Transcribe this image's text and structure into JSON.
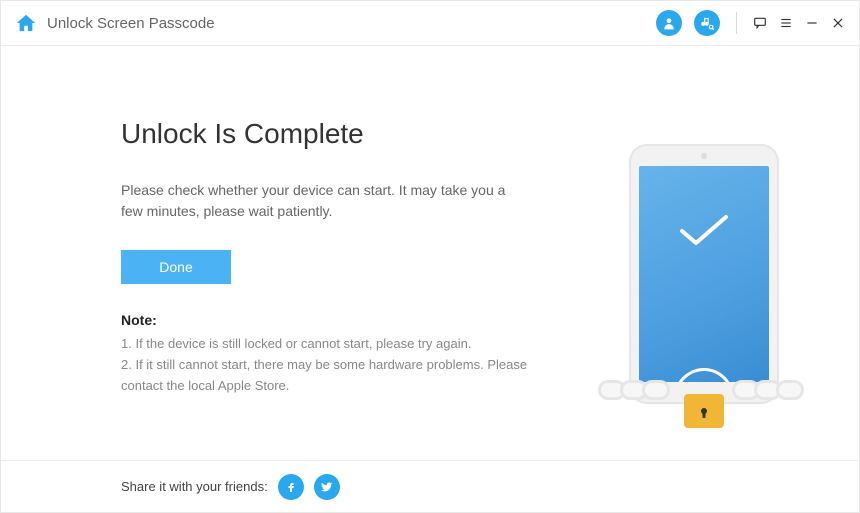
{
  "header": {
    "title": "Unlock Screen Passcode"
  },
  "main": {
    "heading": "Unlock Is Complete",
    "description": "Please check whether your device can start. It may take you a few minutes, please wait patiently.",
    "done_label": "Done",
    "note_title": "Note:",
    "note_1": "1. If the device is still locked or cannot start, please try again.",
    "note_2": "2. If it still cannot start, there may be some hardware problems. Please contact the local Apple Store."
  },
  "footer": {
    "share_label": "Share it with your friends:"
  }
}
